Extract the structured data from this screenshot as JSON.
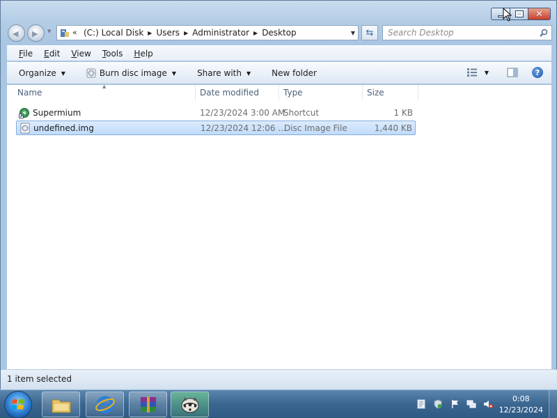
{
  "window": {
    "caption_buttons": {
      "minimize": "minimize",
      "maximize": "maximize",
      "close": "✕"
    }
  },
  "navigation": {
    "address_overflow": "«",
    "breadcrumbs": [
      "(C:) Local Disk",
      "Users",
      "Administrator",
      "Desktop"
    ],
    "search_placeholder": "Search Desktop"
  },
  "menubar": {
    "items": [
      {
        "label": "File",
        "accel": "F",
        "rest": "ile"
      },
      {
        "label": "Edit",
        "accel": "E",
        "rest": "dit"
      },
      {
        "label": "View",
        "accel": "V",
        "rest": "iew"
      },
      {
        "label": "Tools",
        "accel": "T",
        "rest": "ools"
      },
      {
        "label": "Help",
        "accel": "H",
        "rest": "elp"
      }
    ]
  },
  "commandbar": {
    "organize": "Organize",
    "burn": "Burn disc image",
    "share": "Share with",
    "new_folder": "New folder"
  },
  "columns": {
    "name": "Name",
    "date": "Date modified",
    "type": "Type",
    "size": "Size"
  },
  "files": [
    {
      "name": "Supermium",
      "date": "12/23/2024 3:00 AM",
      "type": "Shortcut",
      "size": "1 KB",
      "icon": "shortcut-icon",
      "selected": false
    },
    {
      "name": "undefined.img",
      "date": "12/23/2024 12:06 ...",
      "type": "Disc Image File",
      "size": "1,440 KB",
      "icon": "disc-image-icon",
      "selected": true
    }
  ],
  "status": {
    "text": "1 item selected"
  },
  "taskbar": {
    "pinned": [
      "file-explorer-icon",
      "internet-explorer-icon",
      "winrar-icon",
      "raccoon-app-icon"
    ],
    "clock": {
      "time": "0:08",
      "date": "12/23/2024"
    }
  },
  "colors": {
    "selection": "#c1dcfc",
    "selection_border": "#84acdd",
    "taskbar": "#3a6690"
  }
}
